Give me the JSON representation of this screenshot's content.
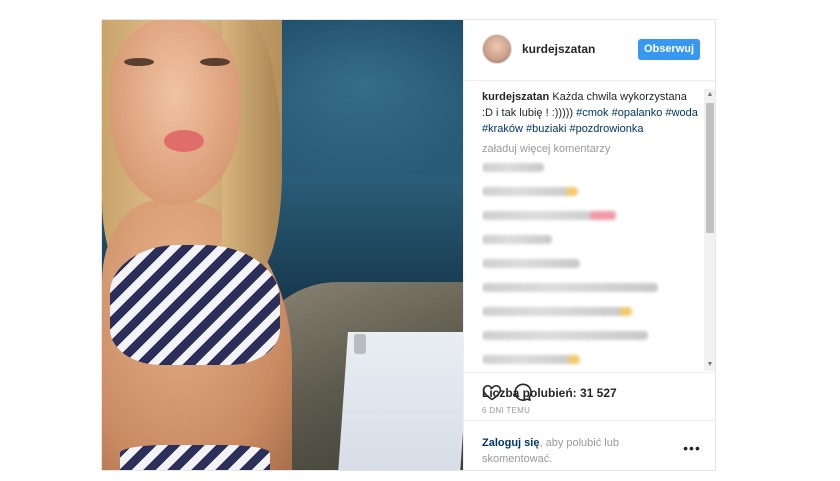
{
  "post": {
    "username": "kurdejszatan",
    "follow_label": "Obserwuj",
    "caption": {
      "user": "kurdejszatan",
      "text": "Każda chwila wykorzystana :D i tak lubię ! :)))))",
      "hashtags": [
        "#cmok",
        "#opalanko",
        "#woda",
        "#kraków",
        "#buziaki",
        "#pozdrowionka"
      ]
    },
    "load_more_label": "załaduj więcej komentarzy",
    "likes_label": "Liczba polubień: 31 527",
    "time_label": "6 DNI TEMU",
    "login": {
      "link": "Zaloguj się",
      "text": ", aby polubić lub skomentować."
    },
    "more_label": "•••"
  },
  "colors": {
    "accent": "#3897f0",
    "link": "#003569",
    "muted": "#999999",
    "border": "#efefef"
  },
  "icons": {
    "like": "heart-icon",
    "comment": "comment-bubble-icon",
    "more": "more-dots-icon"
  }
}
